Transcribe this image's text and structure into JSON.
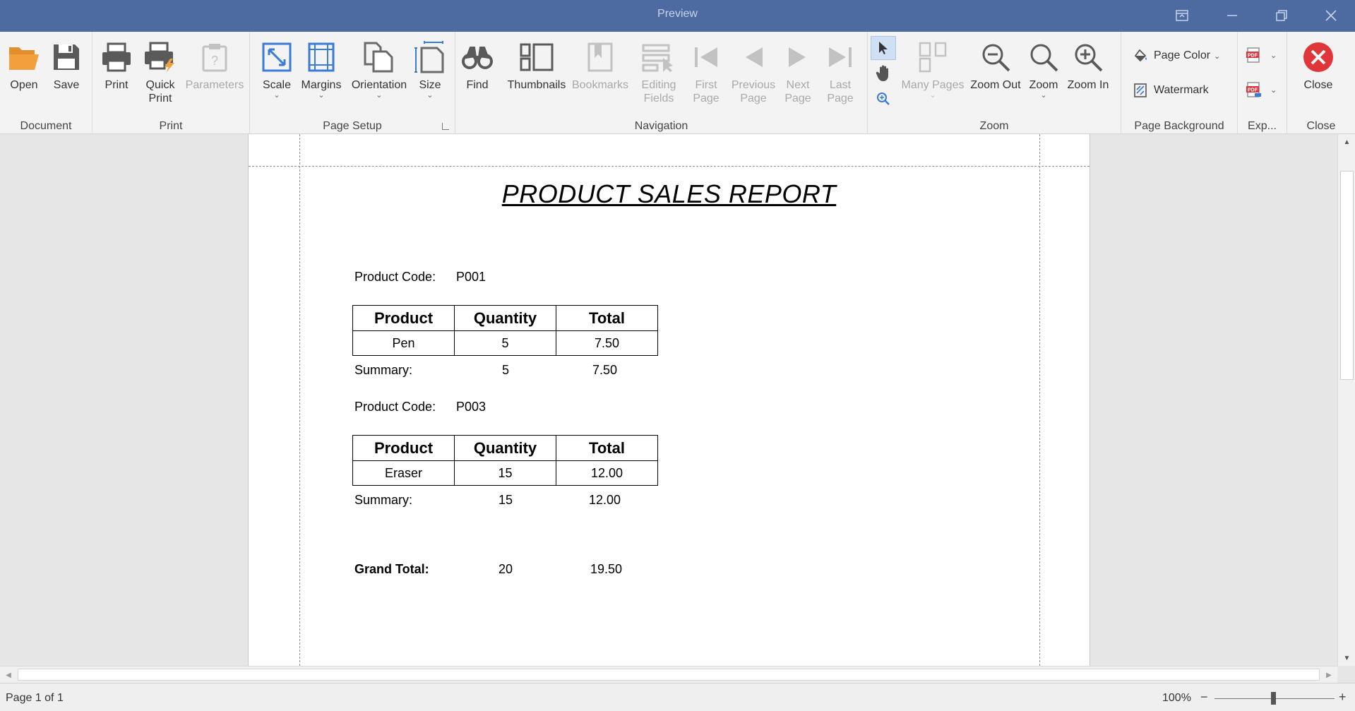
{
  "window": {
    "title": "Preview"
  },
  "ribbon": {
    "groups": {
      "document": "Document",
      "print": "Print",
      "page_setup": "Page Setup",
      "navigation": "Navigation",
      "zoom": "Zoom",
      "page_background": "Page Background",
      "export": "Exp...",
      "close": "Close"
    },
    "buttons": {
      "open": "Open",
      "save": "Save",
      "print": "Print",
      "quick_print_1": "Quick",
      "quick_print_2": "Print",
      "parameters": "Parameters",
      "scale": "Scale",
      "margins": "Margins",
      "orientation": "Orientation",
      "size": "Size",
      "find": "Find",
      "thumbnails": "Thumbnails",
      "bookmarks": "Bookmarks",
      "editing_fields_1": "Editing",
      "editing_fields_2": "Fields",
      "first_page_1": "First",
      "first_page_2": "Page",
      "previous_page_1": "Previous",
      "previous_page_2": "Page",
      "next_page_1": "Next",
      "next_page_2": "Page",
      "last_page_1": "Last",
      "last_page_2": "Page",
      "many_pages": "Many Pages",
      "zoom_out": "Zoom Out",
      "zoom": "Zoom",
      "zoom_in": "Zoom In",
      "page_color": "Page Color",
      "watermark": "Watermark",
      "close": "Close"
    },
    "export_icon_label": "PDF"
  },
  "report": {
    "title": "PRODUCT SALES REPORT",
    "product_code_label": "Product Code:",
    "columns": [
      "Product",
      "Quantity",
      "Total"
    ],
    "summary_label": "Summary:",
    "groups": [
      {
        "code": "P001",
        "row": [
          "Pen",
          "5",
          "7.50"
        ],
        "summary_qty": "5",
        "summary_total": "7.50"
      },
      {
        "code": "P003",
        "row": [
          "Eraser",
          "15",
          "12.00"
        ],
        "summary_qty": "15",
        "summary_total": "12.00"
      }
    ],
    "grand_total_label": "Grand Total:",
    "grand_total_qty": "20",
    "grand_total_value": "19.50"
  },
  "status": {
    "page_info": "Page 1 of 1",
    "zoom_percent": "100%",
    "zoom_minus": "−",
    "zoom_plus": "+"
  },
  "colors": {
    "titlebar": "#4d6ba1",
    "accent_orange": "#f2a03d",
    "close_red": "#e0363a",
    "icon_blue": "#3a7bd5",
    "pdf_red": "#d9363e"
  }
}
